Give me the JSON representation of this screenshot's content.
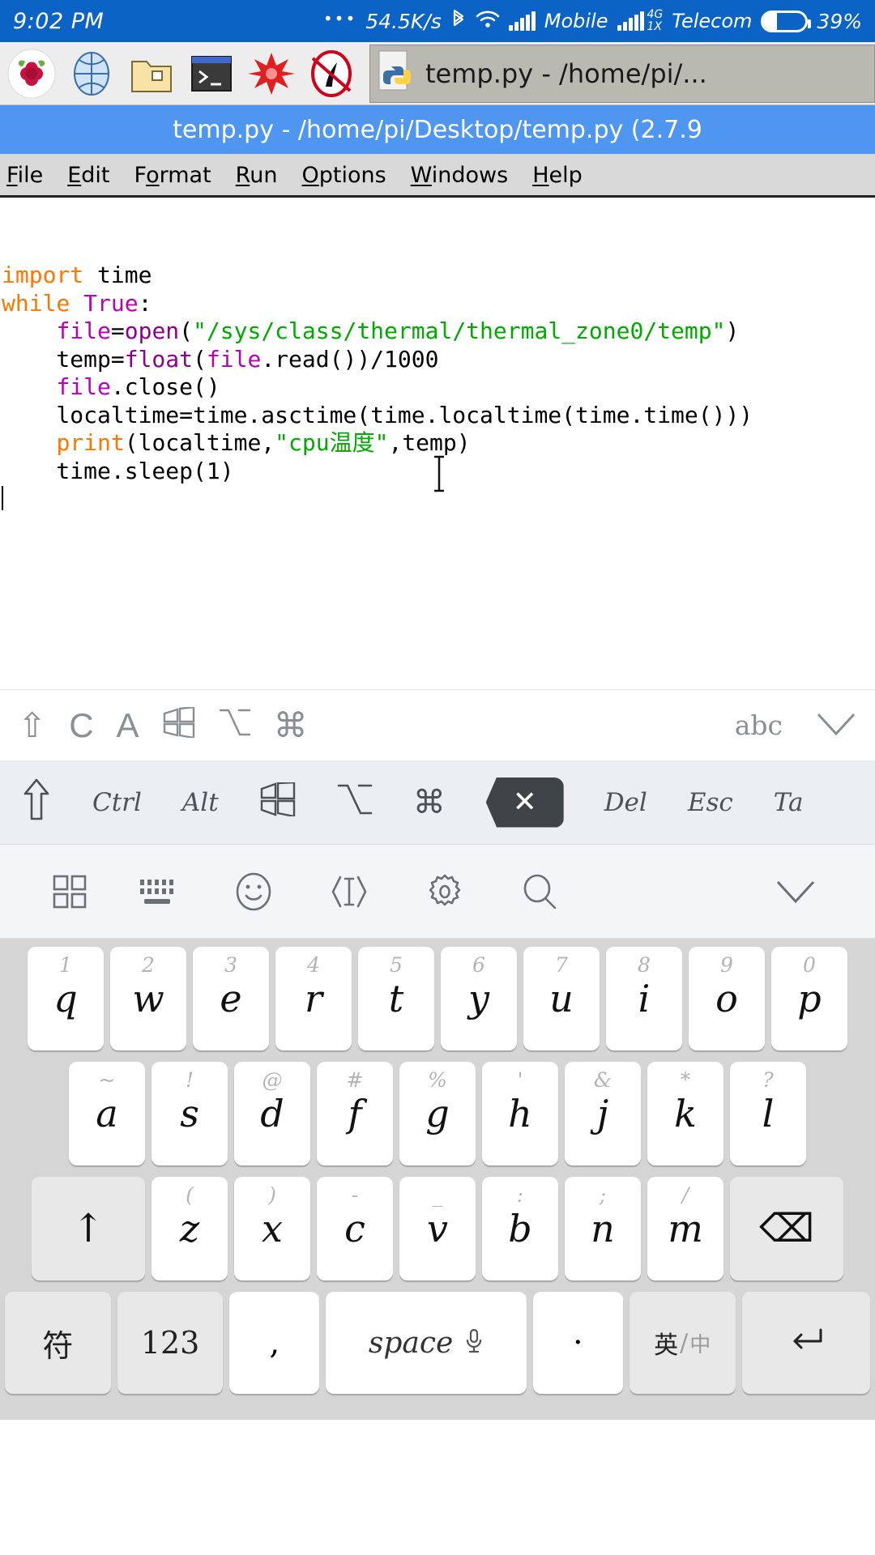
{
  "status_bar": {
    "clock": "9:02 PM",
    "dots": "•••",
    "network_speed": "54.5K/s",
    "bluetooth_icon": "bluetooth-icon",
    "wifi_icon": "wifi-icon",
    "signal_icon": "signal-bars-icon",
    "carrier_primary": "Mobile",
    "network_type_line1": "4G",
    "network_type_line2": "1X",
    "carrier_secondary": "Telecom",
    "battery_percent": "39%",
    "battery_level": 39,
    "background": "#0b63c5",
    "foreground": "#ffffff"
  },
  "taskbar": {
    "launchers": [
      {
        "name": "raspberry-pi-menu-icon",
        "glyph": "raspberry"
      },
      {
        "name": "web-browser-icon",
        "glyph": "globe"
      },
      {
        "name": "file-manager-icon",
        "glyph": "folder"
      },
      {
        "name": "terminal-icon",
        "glyph": "terminal"
      },
      {
        "name": "mathematica-icon",
        "glyph": "starburst"
      },
      {
        "name": "wolfram-icon",
        "glyph": "wolfram"
      }
    ],
    "task_button": {
      "icon": "python-file-icon",
      "label": "temp.py - /home/pi/..."
    },
    "background": "#ededed"
  },
  "window": {
    "title": "temp.py - /home/pi/Desktop/temp.py (2.7.9",
    "title_background": "#4f96f0",
    "menus": [
      {
        "label": "File",
        "mnemonic": "F"
      },
      {
        "label": "Edit",
        "mnemonic": "E"
      },
      {
        "label": "Format",
        "mnemonic": "o"
      },
      {
        "label": "Run",
        "mnemonic": "R"
      },
      {
        "label": "Options",
        "mnemonic": "O"
      },
      {
        "label": "Windows",
        "mnemonic": "W"
      },
      {
        "label": "Help",
        "mnemonic": "H"
      }
    ]
  },
  "editor": {
    "language": "python",
    "colors": {
      "keyword": "#ff7700",
      "builtin": "#900090",
      "string": "#00aa00",
      "definition": "#bb00bb",
      "text": "#000000"
    },
    "lines": [
      [
        {
          "t": "import",
          "c": "kw"
        },
        {
          "t": " time",
          "c": "plain"
        }
      ],
      [
        {
          "t": "while",
          "c": "kw"
        },
        {
          "t": " ",
          "c": "plain"
        },
        {
          "t": "True",
          "c": "def"
        },
        {
          "t": ":",
          "c": "plain"
        }
      ],
      [
        {
          "t": "    ",
          "c": "plain"
        },
        {
          "t": "file",
          "c": "def"
        },
        {
          "t": "=",
          "c": "plain"
        },
        {
          "t": "open",
          "c": "bi"
        },
        {
          "t": "(",
          "c": "plain"
        },
        {
          "t": "\"/sys/class/thermal/thermal_zone0/temp\"",
          "c": "str"
        },
        {
          "t": ")",
          "c": "plain"
        }
      ],
      [
        {
          "t": "    temp=",
          "c": "plain"
        },
        {
          "t": "float",
          "c": "bi"
        },
        {
          "t": "(",
          "c": "plain"
        },
        {
          "t": "file",
          "c": "def"
        },
        {
          "t": ".read())/1000",
          "c": "plain"
        }
      ],
      [
        {
          "t": "    ",
          "c": "plain"
        },
        {
          "t": "file",
          "c": "def"
        },
        {
          "t": ".close()",
          "c": "plain"
        }
      ],
      [
        {
          "t": "    localtime=time.asctime(time.localtime(time.time()))",
          "c": "plain"
        }
      ],
      [
        {
          "t": "    ",
          "c": "plain"
        },
        {
          "t": "print",
          "c": "kw"
        },
        {
          "t": "(localtime,",
          "c": "plain"
        },
        {
          "t": "\"cpu温度\"",
          "c": "str"
        },
        {
          "t": ",temp)",
          "c": "plain"
        }
      ],
      [
        {
          "t": "    time.sleep(1)",
          "c": "plain"
        }
      ],
      [
        {
          "t": "",
          "c": "plain"
        }
      ],
      [
        {
          "t": "__CARET__",
          "c": "plain"
        }
      ]
    ],
    "mouse_cursor_icon": "text-ibeam-cursor"
  },
  "modifier_bar_primary": {
    "keys": [
      {
        "name": "shift-icon",
        "glyph": "⇧"
      },
      {
        "name": "ctrl-letter",
        "glyph": "C"
      },
      {
        "name": "alt-letter",
        "glyph": "A"
      },
      {
        "name": "windows-icon",
        "glyph": "windows"
      },
      {
        "name": "option-icon",
        "glyph": "⌥"
      },
      {
        "name": "command-icon",
        "glyph": "⌘"
      }
    ],
    "abc_label": "abc",
    "collapse_icon": "chevron-down-icon",
    "background": "#ffffff"
  },
  "modifier_bar_secondary": {
    "keys": [
      {
        "name": "shift-key",
        "glyph": "⇧",
        "type": "icon"
      },
      {
        "name": "ctrl-key",
        "label": "Ctrl",
        "type": "text"
      },
      {
        "name": "alt-key",
        "label": "Alt",
        "type": "text"
      },
      {
        "name": "windows-key",
        "glyph": "windows",
        "type": "icon"
      },
      {
        "name": "option-key",
        "glyph": "⌥",
        "type": "icon"
      },
      {
        "name": "command-key",
        "glyph": "⌘",
        "type": "icon"
      },
      {
        "name": "backspace-key",
        "glyph": "✕",
        "type": "filled"
      },
      {
        "name": "del-key",
        "label": "Del",
        "type": "text"
      },
      {
        "name": "esc-key",
        "label": "Esc",
        "type": "text"
      },
      {
        "name": "tab-key",
        "label": "Ta",
        "type": "text"
      }
    ],
    "background": "#eceff1"
  },
  "keyboard_toolbar": {
    "items": [
      {
        "name": "apps-grid-icon"
      },
      {
        "name": "keyboard-layout-icon"
      },
      {
        "name": "emoji-icon"
      },
      {
        "name": "cursor-move-icon"
      },
      {
        "name": "settings-gear-icon"
      },
      {
        "name": "search-icon"
      },
      {
        "name": "collapse-chevron-down-icon"
      }
    ],
    "background": "#f4f5f6"
  },
  "keyboard": {
    "background": "#d5d5d5",
    "rows": [
      {
        "name": "row-qwerty",
        "keys": [
          {
            "main": "q",
            "hint": "1"
          },
          {
            "main": "w",
            "hint": "2"
          },
          {
            "main": "e",
            "hint": "3"
          },
          {
            "main": "r",
            "hint": "4"
          },
          {
            "main": "t",
            "hint": "5"
          },
          {
            "main": "y",
            "hint": "6"
          },
          {
            "main": "u",
            "hint": "7"
          },
          {
            "main": "i",
            "hint": "8"
          },
          {
            "main": "o",
            "hint": "9"
          },
          {
            "main": "p",
            "hint": "0"
          }
        ]
      },
      {
        "name": "row-asdf",
        "keys": [
          {
            "main": "a",
            "hint": "~"
          },
          {
            "main": "s",
            "hint": "!"
          },
          {
            "main": "d",
            "hint": "@"
          },
          {
            "main": "f",
            "hint": "#"
          },
          {
            "main": "g",
            "hint": "%"
          },
          {
            "main": "h",
            "hint": "'"
          },
          {
            "main": "j",
            "hint": "&"
          },
          {
            "main": "k",
            "hint": "*"
          },
          {
            "main": "l",
            "hint": "?"
          }
        ]
      },
      {
        "name": "row-zxcv",
        "keys": [
          {
            "main": "↑",
            "hint": "",
            "wide": true,
            "name": "shift-key"
          },
          {
            "main": "z",
            "hint": "("
          },
          {
            "main": "x",
            "hint": ")"
          },
          {
            "main": "c",
            "hint": "-"
          },
          {
            "main": "v",
            "hint": "_"
          },
          {
            "main": "b",
            "hint": ":"
          },
          {
            "main": "n",
            "hint": ";"
          },
          {
            "main": "m",
            "hint": "/"
          },
          {
            "main": "⌫",
            "hint": "",
            "wide": true,
            "name": "backspace-key"
          }
        ]
      }
    ],
    "bottom_row": {
      "symbols_key": "符",
      "numbers_key": "123",
      "comma_key": ",",
      "space_key": "space",
      "space_mic_icon": "microphone-icon",
      "period_key": "·",
      "lang_key_top": "英",
      "lang_key_bottom": "中",
      "enter_key": "↵"
    }
  }
}
